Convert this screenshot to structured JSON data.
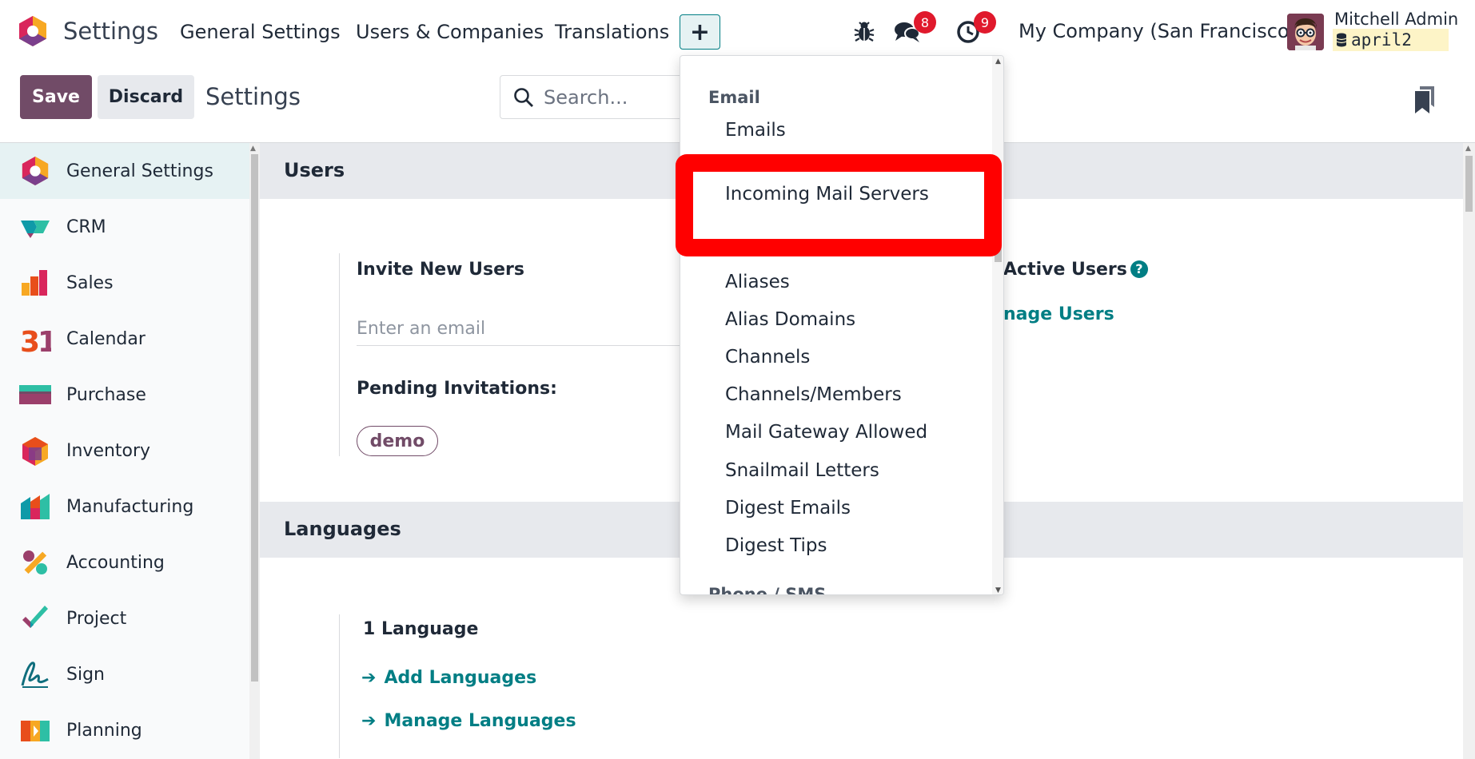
{
  "navbar": {
    "app_name": "Settings",
    "menus": [
      "General Settings",
      "Users & Companies",
      "Translations"
    ],
    "plus_label": "+",
    "messages_count": "8",
    "activities_count": "9",
    "company": "My Company (San Francisco)",
    "user_name": "Mitchell Admin",
    "database": "april2"
  },
  "control_panel": {
    "save_label": "Save",
    "discard_label": "Discard",
    "title": "Settings",
    "search_placeholder": "Search..."
  },
  "sidebar": {
    "items": [
      {
        "label": "General Settings",
        "icon": "settings-icon"
      },
      {
        "label": "CRM",
        "icon": "crm-icon"
      },
      {
        "label": "Sales",
        "icon": "sales-icon"
      },
      {
        "label": "Calendar",
        "icon": "calendar-icon"
      },
      {
        "label": "Purchase",
        "icon": "purchase-icon"
      },
      {
        "label": "Inventory",
        "icon": "inventory-icon"
      },
      {
        "label": "Manufacturing",
        "icon": "manufacturing-icon"
      },
      {
        "label": "Accounting",
        "icon": "accounting-icon"
      },
      {
        "label": "Project",
        "icon": "project-icon"
      },
      {
        "label": "Sign",
        "icon": "sign-icon"
      },
      {
        "label": "Planning",
        "icon": "planning-icon"
      }
    ]
  },
  "users_section": {
    "title": "Users",
    "invite_label": "Invite New Users",
    "email_placeholder": "Enter an email",
    "pending_label": "Pending Invitations:",
    "pending_user": "demo",
    "active_users_label": "Active Users",
    "manage_users_link": "nage Users"
  },
  "languages_section": {
    "title": "Languages",
    "count_label": "1 Language",
    "add_link": "Add Languages",
    "manage_link": "Manage Languages"
  },
  "dropdown": {
    "email_header": "Email",
    "items": [
      "Emails",
      "Incoming Mail Servers",
      "Aliases",
      "Alias Domains",
      "Channels",
      "Channels/Members",
      "Mail Gateway Allowed",
      "Snailmail Letters",
      "Digest Emails",
      "Digest Tips"
    ],
    "next_header": "Phone / SMS"
  },
  "colors": {
    "brand": "#714b67",
    "accent": "#017e84",
    "highlight": "#ff0000"
  }
}
